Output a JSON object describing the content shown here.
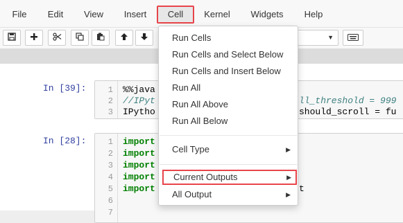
{
  "menubar": {
    "items": [
      {
        "label": "File"
      },
      {
        "label": "Edit"
      },
      {
        "label": "View"
      },
      {
        "label": "Insert"
      },
      {
        "label": "Cell"
      },
      {
        "label": "Kernel"
      },
      {
        "label": "Widgets"
      },
      {
        "label": "Help"
      }
    ],
    "active": "Cell",
    "highlight_color": "#e8444a"
  },
  "toolbar": {
    "icons": [
      "save-icon",
      "plus-icon",
      "scissors-icon",
      "copy-icon",
      "paste-icon",
      "arrow-up-icon",
      "arrow-down-icon",
      "keyboard-icon"
    ],
    "cell_type_select": {
      "value": ""
    }
  },
  "cells": [
    {
      "prompt": "In [39]:",
      "line_numbers": [
        "1",
        "2",
        "3"
      ],
      "lines": [
        "%%java",
        "//IPyt",
        "IPytho"
      ],
      "lines_right": [
        "ll_threshold = 999",
        "should_scroll = fu"
      ]
    },
    {
      "prompt": "In [28]:",
      "line_numbers": [
        "1",
        "2",
        "3",
        "4",
        "5",
        "6",
        "7"
      ],
      "lines": [
        "import",
        "import",
        "import",
        "import",
        "import"
      ],
      "lines_right": [
        "t"
      ]
    }
  ],
  "cell_menu": {
    "items": [
      {
        "label": "Run Cells"
      },
      {
        "label": "Run Cells and Select Below"
      },
      {
        "label": "Run Cells and Insert Below"
      },
      {
        "label": "Run All"
      },
      {
        "label": "Run All Above"
      },
      {
        "label": "Run All Below"
      },
      {
        "label": "Cell Type"
      },
      {
        "label": "Current Outputs"
      },
      {
        "label": "All Output"
      }
    ]
  }
}
